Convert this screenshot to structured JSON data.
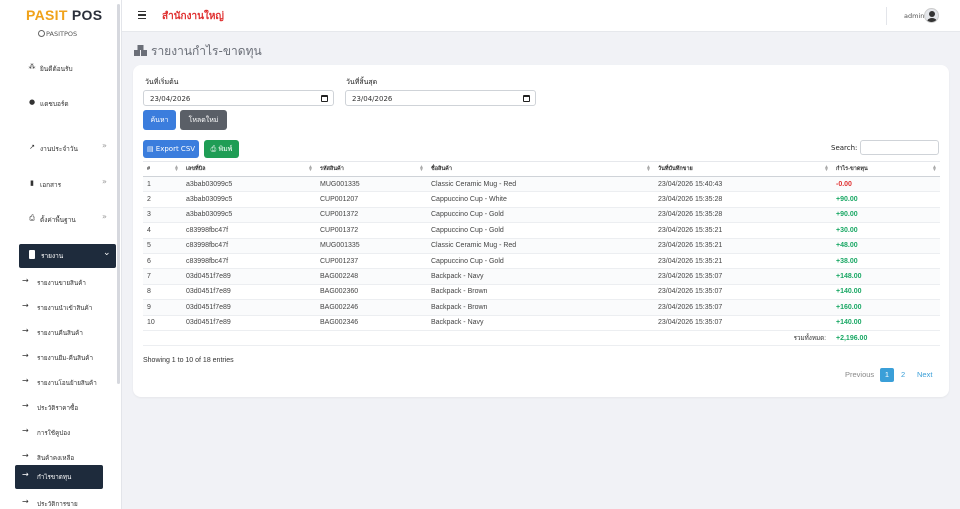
{
  "sidebar": {
    "logo_a": "PASIT",
    "logo_b": "POS",
    "brand_sub": "PASITPOS",
    "items": [
      {
        "label": "ยินดีต้อนรับ",
        "icon": "users-icon"
      },
      {
        "label": "แดชบอร์ด",
        "icon": "dashboard-icon"
      },
      {
        "label": "งานประจำวัน",
        "icon": "trend-icon"
      },
      {
        "label": "เอกสาร",
        "icon": "document-icon"
      },
      {
        "label": "ตั้งค่าพื้นฐาน",
        "icon": "printer-icon"
      }
    ],
    "active": {
      "label": "รายงาน",
      "icon": "bookmark-icon"
    },
    "subitems": [
      {
        "label": "รายงานขายสินค้า"
      },
      {
        "label": "รายงานนำเข้าสินค้า"
      },
      {
        "label": "รายงานคืนสินค้า"
      },
      {
        "label": "รายงานยืม-คืนสินค้า"
      },
      {
        "label": "รายงานโอนย้ายสินค้า"
      },
      {
        "label": "ประวัติราคาซื้อ"
      },
      {
        "label": "การใช้คูปอง"
      },
      {
        "label": "สินค้าคงเหลือ"
      },
      {
        "label": "กำไรขาดทุน"
      },
      {
        "label": "ประวัติการขาย"
      }
    ]
  },
  "header": {
    "branch": "สำนักงานใหญ่",
    "user": "admin"
  },
  "page": {
    "title": "รายงานกำไร-ขาดทุน"
  },
  "filter": {
    "start_label": "วันที่เริ่มต้น",
    "start_value": "23/04/2026",
    "end_label": "วันที่สิ้นสุด",
    "end_value": "23/04/2026",
    "search_btn": "ค้นหา",
    "reload_btn": "โหลดใหม่"
  },
  "toolbar": {
    "export_csv": "Export CSV",
    "print": "พิมพ์",
    "search_label": "Search:"
  },
  "table": {
    "headers": [
      "#",
      "เลขที่บิล",
      "รหัสสินค้า",
      "ชื่อสินค้า",
      "วันที่บันทึกขาย",
      "กำไร-ขาดทุน"
    ],
    "rows": [
      [
        "1",
        "a3bab03099c5",
        "MUG001335",
        "Classic Ceramic Mug - Red",
        "23/04/2026 15:40:43",
        "-0.00"
      ],
      [
        "2",
        "a3bab03099c5",
        "CUP001207",
        "Cappuccino Cup - White",
        "23/04/2026 15:35:28",
        "+90.00"
      ],
      [
        "3",
        "a3bab03099c5",
        "CUP001372",
        "Cappuccino Cup - Gold",
        "23/04/2026 15:35:28",
        "+90.00"
      ],
      [
        "4",
        "c83998fbc47f",
        "CUP001372",
        "Cappuccino Cup - Gold",
        "23/04/2026 15:35:21",
        "+30.00"
      ],
      [
        "5",
        "c83998fbc47f",
        "MUG001335",
        "Classic Ceramic Mug - Red",
        "23/04/2026 15:35:21",
        "+48.00"
      ],
      [
        "6",
        "c83998fbc47f",
        "CUP001237",
        "Cappuccino Cup - Gold",
        "23/04/2026 15:35:21",
        "+38.00"
      ],
      [
        "7",
        "03d0451f7e89",
        "BAG002248",
        "Backpack - Navy",
        "23/04/2026 15:35:07",
        "+148.00"
      ],
      [
        "8",
        "03d0451f7e89",
        "BAG002360",
        "Backpack - Brown",
        "23/04/2026 15:35:07",
        "+140.00"
      ],
      [
        "9",
        "03d0451f7e89",
        "BAG002246",
        "Backpack - Brown",
        "23/04/2026 15:35:07",
        "+160.00"
      ],
      [
        "10",
        "03d0451f7e89",
        "BAG002346",
        "Backpack - Navy",
        "23/04/2026 15:35:07",
        "+140.00"
      ]
    ],
    "total_label": "รวมทั้งหมด:",
    "total_value": "+2,196.00"
  },
  "footer": {
    "showing": "Showing 1 to 10 of 18 entries",
    "prev": "Previous",
    "page1": "1",
    "page2": "2",
    "next": "Next"
  },
  "colors": {
    "sidebar_active": "#1e2b3c",
    "primary": "#3b7ddd",
    "success": "#1f9d55",
    "profit_positive": "#1aa865",
    "profit_negative": "#e03131",
    "branch": "#e03131",
    "logo_accent": "#f0a21a"
  }
}
